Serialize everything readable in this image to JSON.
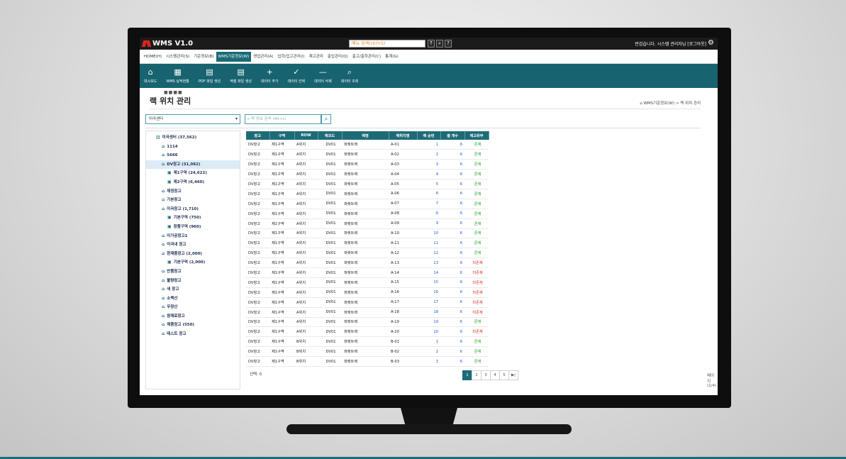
{
  "app": {
    "title": "WMS V1.0",
    "menu_search_placeholder": "메뉴 검색(ctrl+S)",
    "top_buttons": [
      "↑",
      "🔍",
      "?"
    ],
    "greeting": "반갑습니다. 시스템 관리자님 [로그아웃]"
  },
  "menu_tabs": [
    {
      "label": "HOME(H)",
      "active": false
    },
    {
      "label": "시스템관리(S)",
      "active": false
    },
    {
      "label": "기준정보(B)",
      "active": false
    },
    {
      "label": "WMS기준정보(W)",
      "active": true
    },
    {
      "label": "영업관리(A)",
      "active": false
    },
    {
      "label": "입하/입고관리(I)",
      "active": false
    },
    {
      "label": "재고관리",
      "active": false
    },
    {
      "label": "출입관리(Q)",
      "active": false
    },
    {
      "label": "출고/출하관리(C)",
      "active": false
    },
    {
      "label": "통계(G)",
      "active": false
    }
  ],
  "toolbar": [
    {
      "icon": "home-icon",
      "label": "대시보드"
    },
    {
      "icon": "building-icon",
      "label": "WMS 실적현황"
    },
    {
      "icon": "pdf-file-icon",
      "label": "PDF 파일 생성"
    },
    {
      "icon": "excel-file-icon",
      "label": "엑셀 파일 생성"
    },
    {
      "icon": "plus-icon",
      "label": "데이터 추가"
    },
    {
      "icon": "check-icon",
      "label": "데이터 선택"
    },
    {
      "icon": "minus-icon",
      "label": "데이터 삭제"
    },
    {
      "icon": "search-icon",
      "label": "데이터 조회"
    }
  ],
  "page": {
    "title": "랙 위치 관리",
    "breadcrumb": "WMS기준정보(W) > 랙 위치 관리",
    "center_select": "미곡센터",
    "rack_search_placeholder": "랙 정보 검색 (Alt+L)"
  },
  "tree": [
    {
      "label": "미곡센터 (37,562)",
      "level": 0,
      "selected": false
    },
    {
      "label": "1114",
      "level": 1,
      "selected": false
    },
    {
      "label": "5666",
      "level": 1,
      "selected": false
    },
    {
      "label": "DV창고 (31,082)",
      "level": 1,
      "selected": true
    },
    {
      "label": "제1구역 (24,622)",
      "level": 2,
      "selected": false
    },
    {
      "label": "제2구역 (6,460)",
      "level": 2,
      "selected": false
    },
    {
      "label": "제정창고",
      "level": 1,
      "selected": false
    },
    {
      "label": "기본창고",
      "level": 1,
      "selected": false
    },
    {
      "label": "미곡창고 (1,710)",
      "level": 1,
      "selected": false
    },
    {
      "label": "기본구역 (750)",
      "level": 2,
      "selected": false
    },
    {
      "label": "창품구역 (960)",
      "level": 2,
      "selected": false
    },
    {
      "label": "미가공창고1",
      "level": 1,
      "selected": false
    },
    {
      "label": "미곡내 창고",
      "level": 1,
      "selected": false
    },
    {
      "label": "현재품창고 (2,000)",
      "level": 1,
      "selected": false
    },
    {
      "label": "기본구역 (2,000)",
      "level": 2,
      "selected": false
    },
    {
      "label": "반품창고",
      "level": 1,
      "selected": false
    },
    {
      "label": "불량창고",
      "level": 1,
      "selected": false
    },
    {
      "label": "새 창고",
      "level": 1,
      "selected": false
    },
    {
      "label": "소백산",
      "level": 1,
      "selected": false
    },
    {
      "label": "우창산",
      "level": 1,
      "selected": false
    },
    {
      "label": "원재료창고",
      "level": 1,
      "selected": false
    },
    {
      "label": "제품창고 (550)",
      "level": 1,
      "selected": false
    },
    {
      "label": "테스트 창고",
      "level": 1,
      "selected": false
    }
  ],
  "table": {
    "columns": [
      "창고",
      "구역",
      "ROW",
      "랙코드",
      "랙명",
      "랙위치명",
      "랙 순번",
      "셀 개수",
      "재고유무"
    ],
    "rows": [
      [
        "DV창고",
        "제1구역",
        "A위치",
        "DV01",
        "파렛트랙",
        "A-01",
        "1",
        "6",
        "존재"
      ],
      [
        "DV창고",
        "제1구역",
        "A위치",
        "DV01",
        "파렛트랙",
        "A-02",
        "2",
        "6",
        "존재"
      ],
      [
        "DV창고",
        "제1구역",
        "A위치",
        "DV01",
        "파렛트랙",
        "A-03",
        "3",
        "6",
        "존재"
      ],
      [
        "DV창고",
        "제1구역",
        "A위치",
        "DV01",
        "파렛트랙",
        "A-04",
        "4",
        "6",
        "존재"
      ],
      [
        "DV창고",
        "제1구역",
        "A위치",
        "DV01",
        "파렛트랙",
        "A-05",
        "5",
        "6",
        "존재"
      ],
      [
        "DV창고",
        "제1구역",
        "A위치",
        "DV01",
        "파렛트랙",
        "A-06",
        "6",
        "6",
        "존재"
      ],
      [
        "DV창고",
        "제1구역",
        "A위치",
        "DV01",
        "파렛트랙",
        "A-07",
        "7",
        "6",
        "존재"
      ],
      [
        "DV창고",
        "제1구역",
        "A위치",
        "DV01",
        "파렛트랙",
        "A-08",
        "8",
        "6",
        "존재"
      ],
      [
        "DV창고",
        "제1구역",
        "A위치",
        "DV01",
        "파렛트랙",
        "A-09",
        "9",
        "6",
        "존재"
      ],
      [
        "DV창고",
        "제1구역",
        "A위치",
        "DV01",
        "파렛트랙",
        "A-10",
        "10",
        "6",
        "존재"
      ],
      [
        "DV창고",
        "제1구역",
        "A위치",
        "DV01",
        "파렛트랙",
        "A-11",
        "11",
        "6",
        "존재"
      ],
      [
        "DV창고",
        "제1구역",
        "A위치",
        "DV01",
        "파렛트랙",
        "A-12",
        "12",
        "6",
        "존재"
      ],
      [
        "DV창고",
        "제1구역",
        "A위치",
        "DV01",
        "파렛트랙",
        "A-13",
        "13",
        "6",
        "미존재"
      ],
      [
        "DV창고",
        "제1구역",
        "A위치",
        "DV01",
        "파렛트랙",
        "A-14",
        "14",
        "6",
        "미존재"
      ],
      [
        "DV창고",
        "제1구역",
        "A위치",
        "DV01",
        "파렛트랙",
        "A-15",
        "15",
        "6",
        "미존재"
      ],
      [
        "DV창고",
        "제1구역",
        "A위치",
        "DV01",
        "파렛트랙",
        "A-16",
        "16",
        "6",
        "미존재"
      ],
      [
        "DV창고",
        "제1구역",
        "A위치",
        "DV01",
        "파렛트랙",
        "A-17",
        "17",
        "6",
        "미존재"
      ],
      [
        "DV창고",
        "제1구역",
        "A위치",
        "DV01",
        "파렛트랙",
        "A-18",
        "18",
        "6",
        "미존재"
      ],
      [
        "DV창고",
        "제1구역",
        "A위치",
        "DV01",
        "파렛트랙",
        "A-19",
        "19",
        "6",
        "존재"
      ],
      [
        "DV창고",
        "제1구역",
        "A위치",
        "DV01",
        "파렛트랙",
        "A-20",
        "20",
        "6",
        "미존재"
      ],
      [
        "DV창고",
        "제1구역",
        "B위치",
        "DV01",
        "파렛트랙",
        "B-01",
        "1",
        "6",
        "존재"
      ],
      [
        "DV창고",
        "제1구역",
        "B위치",
        "DV01",
        "파렛트랙",
        "B-02",
        "2",
        "6",
        "존재"
      ],
      [
        "DV창고",
        "제1구역",
        "B위치",
        "DV01",
        "파렛트랙",
        "B-03",
        "3",
        "6",
        "존재"
      ]
    ]
  },
  "footer": {
    "selected": "선택: 0",
    "pages": [
      "1",
      "2",
      "3",
      "4",
      "5",
      "▶|"
    ],
    "page_info": "페이지(1/4)"
  },
  "colors": {
    "accent": "#17636f",
    "header": "#1e6b78",
    "exists": "#1a9a1a",
    "missing": "#d9251d",
    "number": "#1a56d8"
  }
}
